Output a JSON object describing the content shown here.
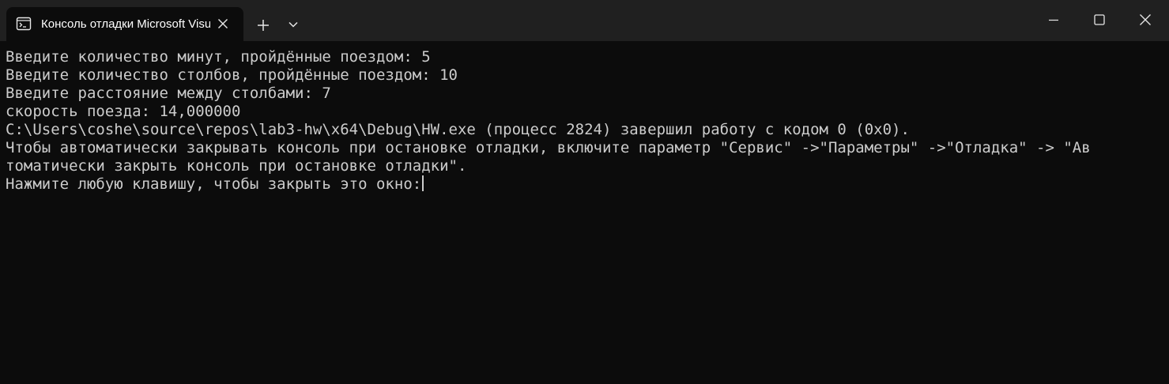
{
  "window": {
    "tab_title": "Консоль отладки Microsoft Visual Studio",
    "icons": {
      "tab_icon": "terminal-icon",
      "tab_close": "close-icon",
      "new_tab": "plus-icon",
      "dropdown": "chevron-down-icon",
      "minimize": "minimize-icon",
      "maximize": "maximize-icon",
      "close": "close-icon"
    }
  },
  "console": {
    "lines": [
      "Введите количество минут, пройдённые поездом: 5",
      "Введите количество столбов, пройдённые поездом: 10",
      "Введите расстояние между столбами: 7",
      "скорость поезда: 14,000000",
      "C:\\Users\\coshe\\source\\repos\\lab3-hw\\x64\\Debug\\HW.exe (процесс 2824) завершил работу с кодом 0 (0x0).",
      "Чтобы автоматически закрывать консоль при остановке отладки, включите параметр \"Сервис\" ->\"Параметры\" ->\"Отладка\" -> \"Ав",
      "томатически закрыть консоль при остановке отладки\".",
      "Нажмите любую клавишу, чтобы закрыть это окно:"
    ]
  },
  "colors": {
    "titlebar_bg": "#202020",
    "console_bg": "#0c0c0c",
    "console_text": "#cccccc"
  }
}
